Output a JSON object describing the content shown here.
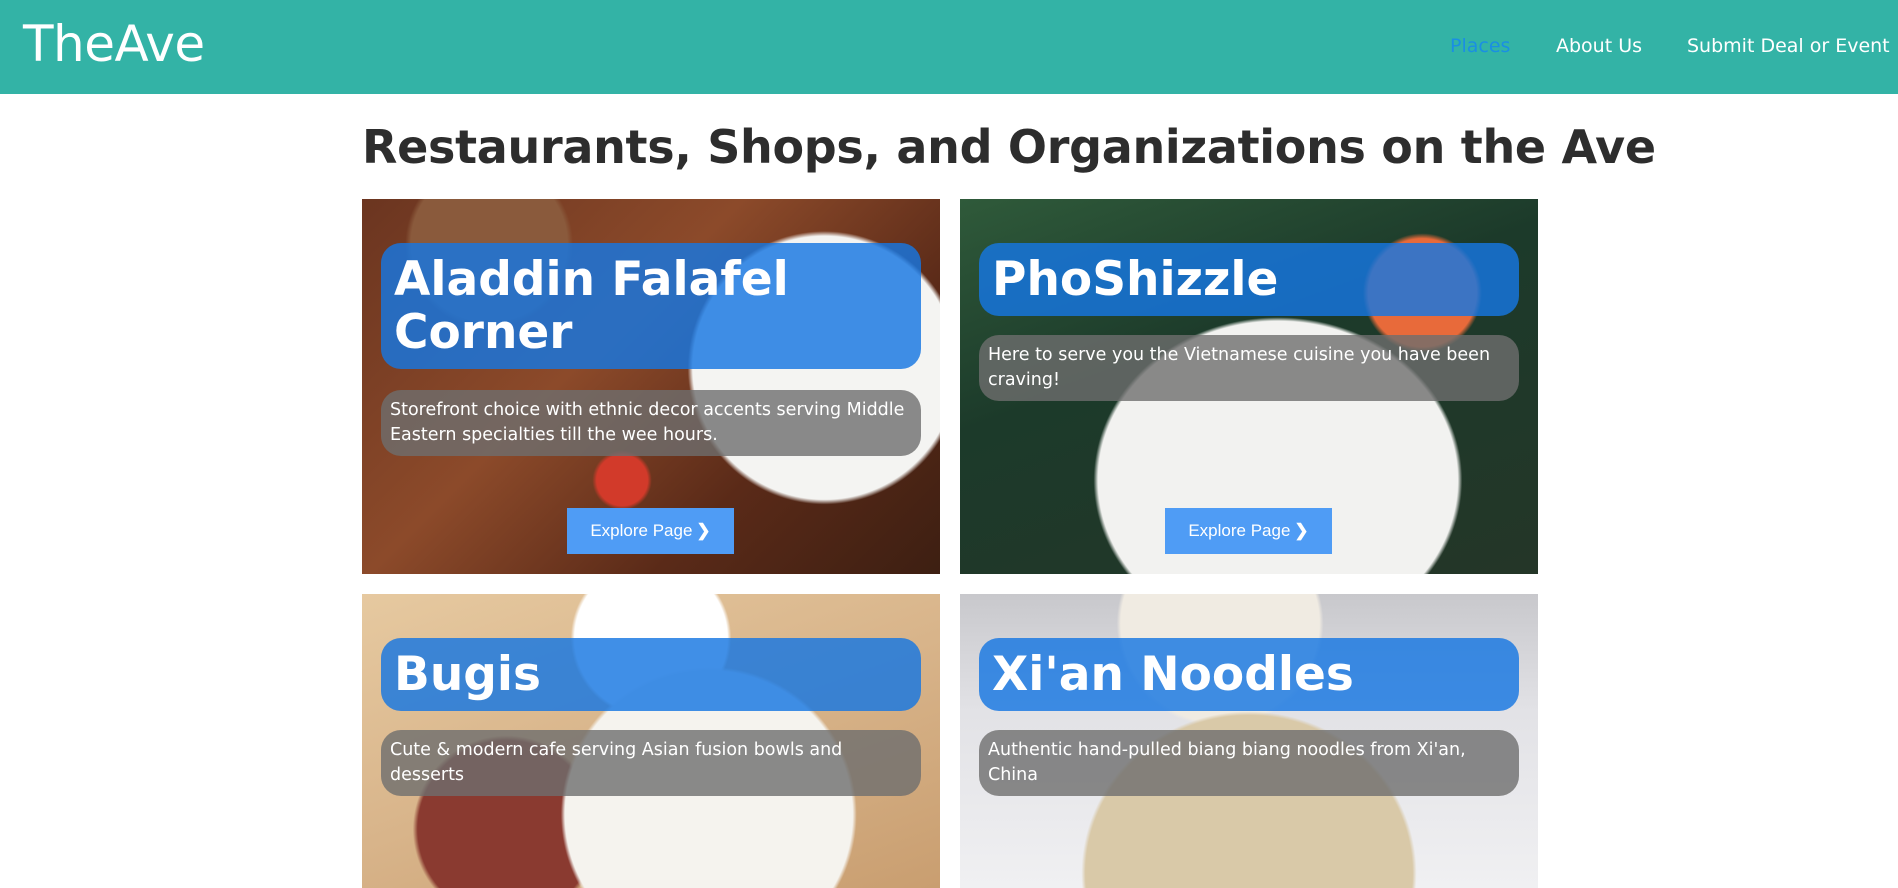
{
  "brand": "TheAve",
  "nav": {
    "places": "Places",
    "about": "About Us",
    "submit": "Submit Deal or Event"
  },
  "page": {
    "title": "Restaurants, Shops, and Organizations on the Ave"
  },
  "cards": [
    {
      "title": "Aladdin Falafel Corner",
      "description": "Storefront choice with ethnic decor accents serving Middle Eastern specialties till the wee hours.",
      "button": "Explore Page"
    },
    {
      "title": "PhoShizzle",
      "description": "Here to serve you the Vietnamese cuisine you have been craving!",
      "button": "Explore Page"
    },
    {
      "title": "Bugis",
      "description": "Cute & modern cafe serving Asian fusion bowls and desserts"
    },
    {
      "title": "Xi'an Noodles",
      "description": "Authentic hand-pulled biang biang noodles from Xi'an, China"
    }
  ],
  "icons": {
    "explore_chevron": "chevron-right-icon"
  },
  "colors": {
    "navbar": "#33b3a6",
    "active_link": "#1a8fe3",
    "card_title_bg": "#1676e2",
    "explore_button": "#4f9cf5"
  }
}
